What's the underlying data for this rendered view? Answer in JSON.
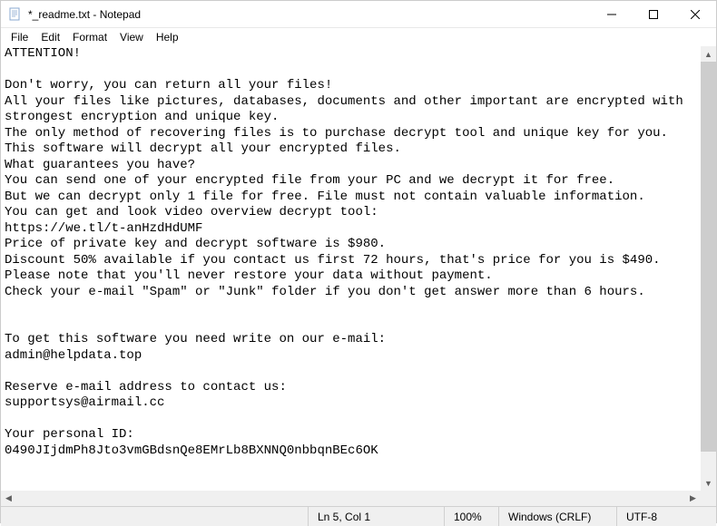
{
  "title": "*_readme.txt - Notepad",
  "menu": {
    "file": "File",
    "edit": "Edit",
    "format": "Format",
    "view": "View",
    "help": "Help"
  },
  "body": "ATTENTION!\n\nDon't worry, you can return all your files!\nAll your files like pictures, databases, documents and other important are encrypted with strongest encryption and unique key.\nThe only method of recovering files is to purchase decrypt tool and unique key for you.\nThis software will decrypt all your encrypted files.\nWhat guarantees you have?\nYou can send one of your encrypted file from your PC and we decrypt it for free.\nBut we can decrypt only 1 file for free. File must not contain valuable information.\nYou can get and look video overview decrypt tool:\nhttps://we.tl/t-anHzdHdUMF\nPrice of private key and decrypt software is $980.\nDiscount 50% available if you contact us first 72 hours, that's price for you is $490.\nPlease note that you'll never restore your data without payment.\nCheck your e-mail \"Spam\" or \"Junk\" folder if you don't get answer more than 6 hours.\n\n\nTo get this software you need write on our e-mail:\nadmin@helpdata.top\n\nReserve e-mail address to contact us:\nsupportsys@airmail.cc\n\nYour personal ID:\n0490JIjdmPh8Jto3vmGBdsnQe8EMrLb8BXNNQ0nbbqnBEc6OK",
  "status": {
    "position": "Ln 5, Col 1",
    "zoom": "100%",
    "eol": "Windows (CRLF)",
    "encoding": "UTF-8"
  }
}
